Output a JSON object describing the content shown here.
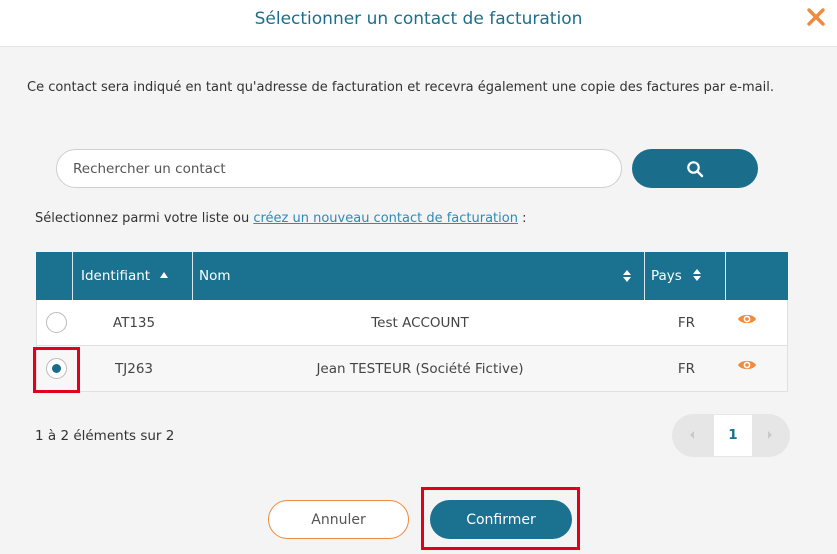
{
  "header": {
    "title": "Sélectionner un contact de facturation"
  },
  "description": "Ce contact sera indiqué en tant qu'adresse de facturation et recevra également une copie des factures par e-mail.",
  "search": {
    "placeholder": "Rechercher un contact"
  },
  "select_line": {
    "prefix": "Sélectionnez parmi votre liste ou ",
    "link": "créez un nouveau contact de facturation",
    "suffix": " :"
  },
  "table": {
    "columns": [
      "Identifiant",
      "Nom",
      "Pays"
    ],
    "sort": {
      "identifiant": "ascending"
    },
    "rows": [
      {
        "id": "AT135",
        "name": "Test ACCOUNT",
        "country": "FR",
        "selected": false
      },
      {
        "id": "TJ263",
        "name": "Jean TESTEUR (Société Fictive)",
        "country": "FR",
        "selected": true
      }
    ]
  },
  "footer": {
    "count": "1 à 2 éléments sur 2",
    "current_page": "1"
  },
  "buttons": {
    "cancel": "Annuler",
    "confirm": "Confirmer"
  },
  "colors": {
    "primary": "#1b7190",
    "accent": "#f08a3c",
    "highlight": "#e0001b"
  }
}
